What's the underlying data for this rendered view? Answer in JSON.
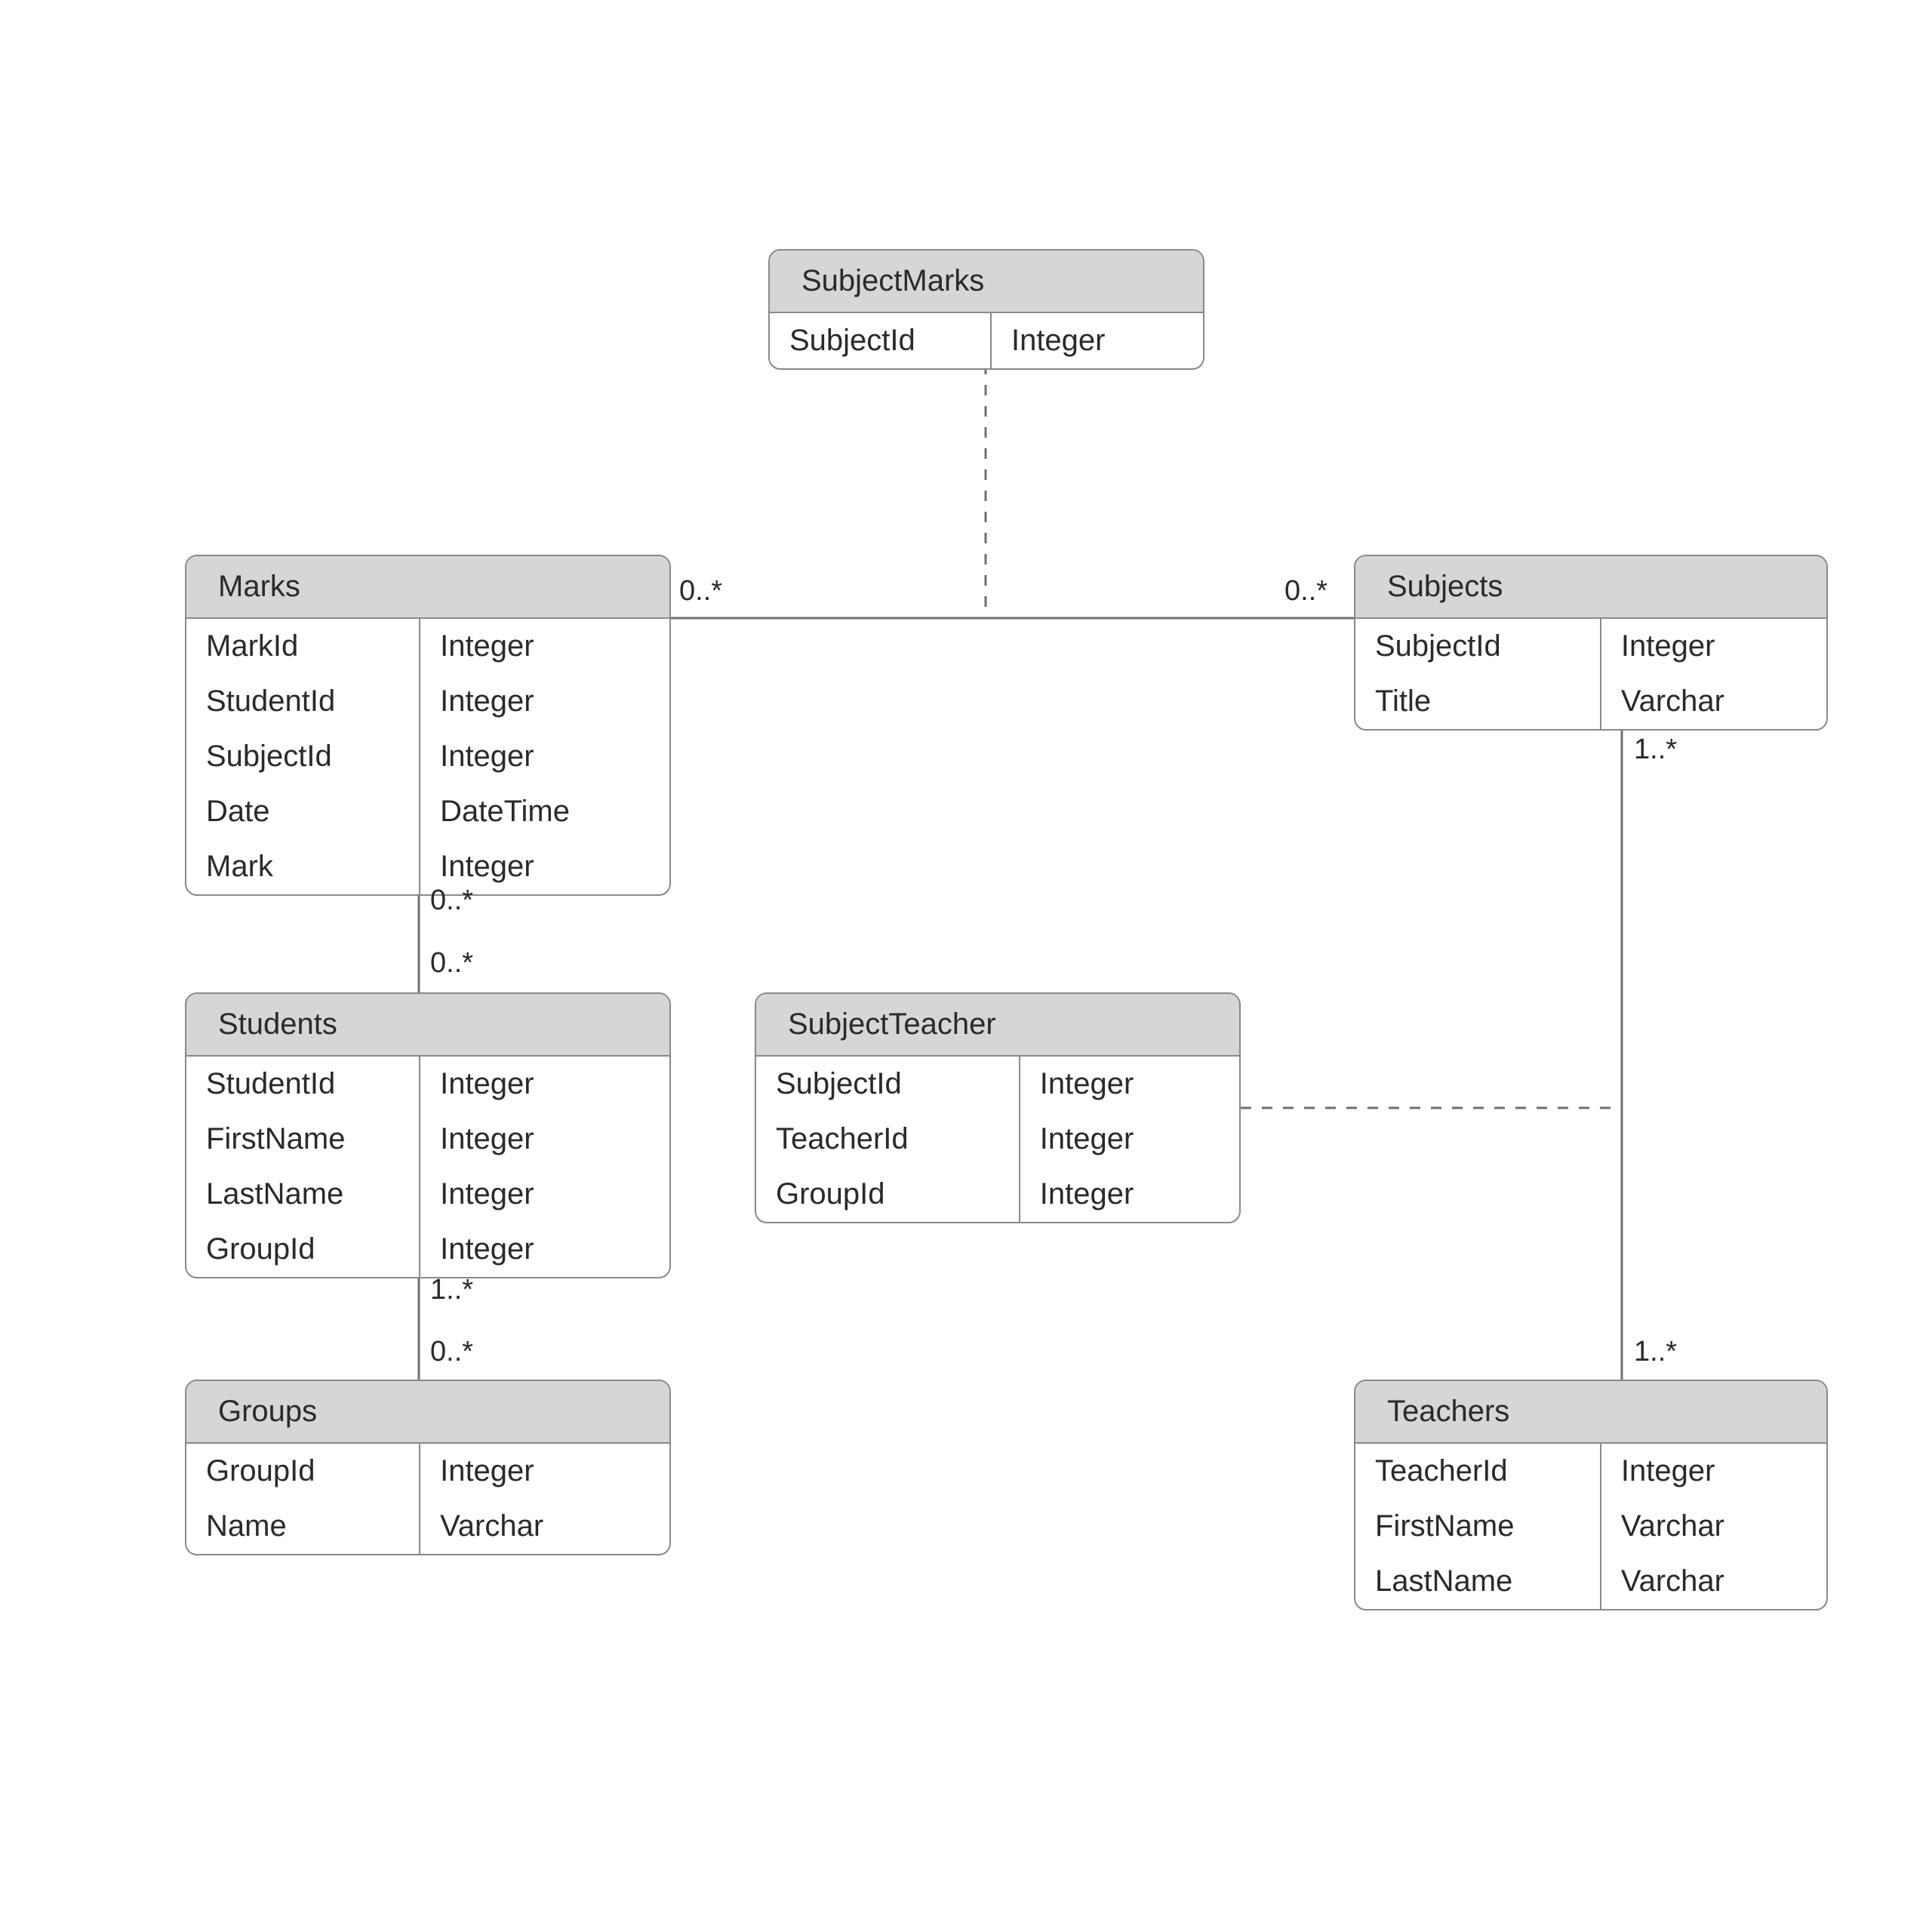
{
  "entities": {
    "subjectMarks": {
      "title": "SubjectMarks",
      "rows": [
        {
          "name": "SubjectId",
          "type": "Integer"
        }
      ]
    },
    "marks": {
      "title": "Marks",
      "rows": [
        {
          "name": "MarkId",
          "type": "Integer"
        },
        {
          "name": "StudentId",
          "type": "Integer"
        },
        {
          "name": "SubjectId",
          "type": "Integer"
        },
        {
          "name": "Date",
          "type": "DateTime"
        },
        {
          "name": "Mark",
          "type": "Integer"
        }
      ]
    },
    "subjects": {
      "title": "Subjects",
      "rows": [
        {
          "name": "SubjectId",
          "type": "Integer"
        },
        {
          "name": "Title",
          "type": "Varchar"
        }
      ]
    },
    "students": {
      "title": "Students",
      "rows": [
        {
          "name": "StudentId",
          "type": "Integer"
        },
        {
          "name": "FirstName",
          "type": "Integer"
        },
        {
          "name": "LastName",
          "type": "Integer"
        },
        {
          "name": "GroupId",
          "type": "Integer"
        }
      ]
    },
    "subjectTeacher": {
      "title": "SubjectTeacher",
      "rows": [
        {
          "name": "SubjectId",
          "type": "Integer"
        },
        {
          "name": "TeacherId",
          "type": "Integer"
        },
        {
          "name": "GroupId",
          "type": "Integer"
        }
      ]
    },
    "groups": {
      "title": "Groups",
      "rows": [
        {
          "name": "GroupId",
          "type": "Integer"
        },
        {
          "name": "Name",
          "type": "Varchar"
        }
      ]
    },
    "teachers": {
      "title": "Teachers",
      "rows": [
        {
          "name": "TeacherId",
          "type": "Integer"
        },
        {
          "name": "FirstName",
          "type": "Varchar"
        },
        {
          "name": "LastName",
          "type": "Varchar"
        }
      ]
    }
  },
  "multiplicities": {
    "marksSubjects_left": "0..*",
    "marksSubjects_right": "0..*",
    "marksStudents_top": "0..*",
    "marksStudents_bot": "0..*",
    "studentsGroups_top": "1..*",
    "studentsGroups_bot": "0..*",
    "subjectsTeachers_top": "1..*",
    "subjectsTeachers_bot": "1..*"
  }
}
